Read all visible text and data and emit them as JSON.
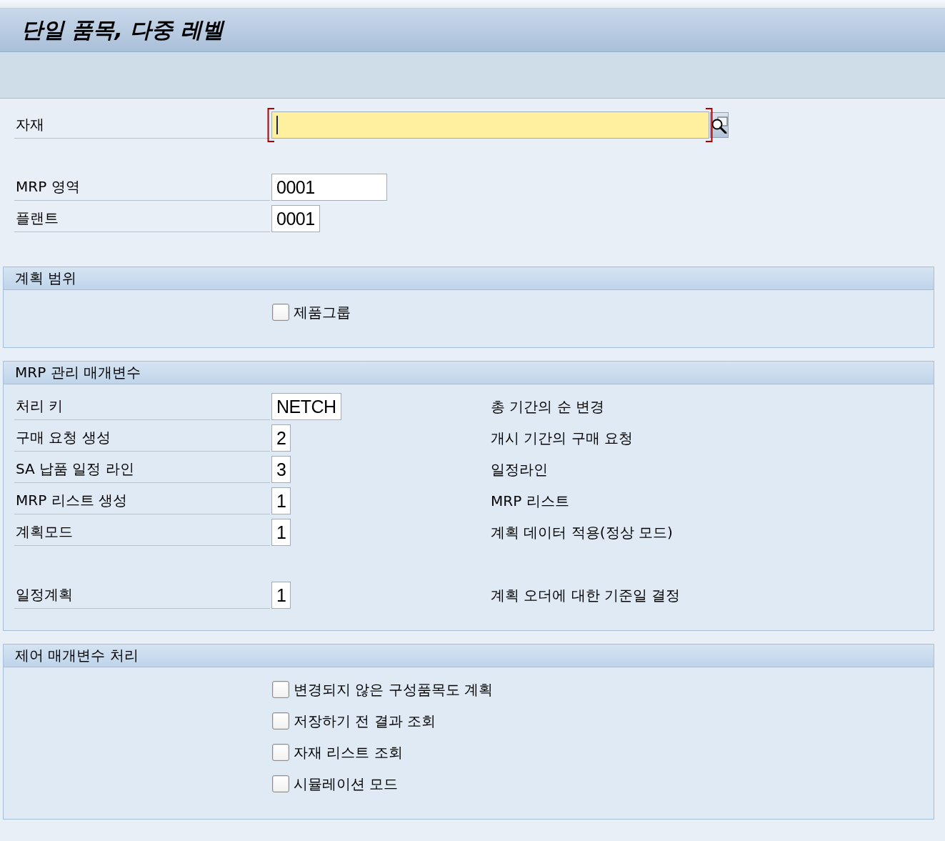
{
  "window": {
    "title": "단일 품목, 다중 레벨"
  },
  "selection": {
    "blocks": [
      [
        {
          "label": "자재",
          "required": true,
          "focused": true,
          "search_help": true
        }
      ],
      [
        {
          "label": "MRP 영역",
          "value": "0001",
          "required": false,
          "focused": false,
          "search_help": false
        },
        {
          "label": "플랜트",
          "value": "0001",
          "required": false,
          "focused": false,
          "search_help": false
        }
      ]
    ]
  },
  "sections": [
    {
      "title": "계획 범위",
      "blocks": [
        [
          {
            "kind": "checkbox",
            "label": "제품그룹",
            "checked": false
          }
        ]
      ]
    },
    {
      "title": "MRP 관리 매개변수",
      "blocks": [
        [
          {
            "kind": "field",
            "label": "처리 키",
            "value": "NETCH",
            "description": "총 기간의 순 변경"
          },
          {
            "kind": "field",
            "label": "구매 요청 생성",
            "value": "2",
            "description": "개시 기간의 구매 요청"
          },
          {
            "kind": "field",
            "label": "SA 납품 일정 라인",
            "value": "3",
            "description": "일정라인"
          },
          {
            "kind": "field",
            "label": "MRP 리스트 생성",
            "value": "1",
            "description": "MRP 리스트"
          },
          {
            "kind": "field",
            "label": "계획모드",
            "value": "1",
            "description": "계획 데이터 적용(정상 모드)"
          }
        ],
        [
          {
            "kind": "field",
            "label": "일정계획",
            "value": "1",
            "description": "계획 오더에 대한 기준일 결정"
          }
        ]
      ]
    },
    {
      "title": "제어 매개변수 처리",
      "blocks": [
        [
          {
            "kind": "checkbox",
            "label": "변경되지 않은 구성품목도 계획",
            "checked": false
          },
          {
            "kind": "checkbox",
            "label": "저장하기 전 결과 조회",
            "checked": false
          },
          {
            "kind": "checkbox",
            "label": "자재 리스트 조회",
            "checked": false
          },
          {
            "kind": "checkbox",
            "label": "시뮬레이션 모드",
            "checked": false
          }
        ]
      ]
    }
  ]
}
